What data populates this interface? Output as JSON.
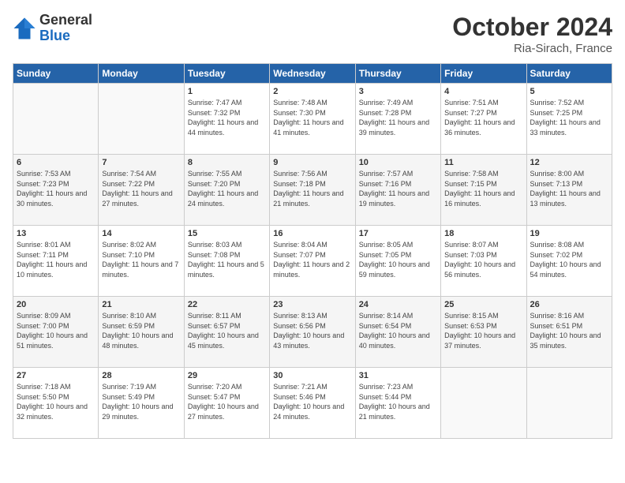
{
  "logo": {
    "general": "General",
    "blue": "Blue"
  },
  "title": "October 2024",
  "location": "Ria-Sirach, France",
  "days_header": [
    "Sunday",
    "Monday",
    "Tuesday",
    "Wednesday",
    "Thursday",
    "Friday",
    "Saturday"
  ],
  "weeks": [
    [
      {
        "day": "",
        "sunrise": "",
        "sunset": "",
        "daylight": ""
      },
      {
        "day": "",
        "sunrise": "",
        "sunset": "",
        "daylight": ""
      },
      {
        "day": "1",
        "sunrise": "Sunrise: 7:47 AM",
        "sunset": "Sunset: 7:32 PM",
        "daylight": "Daylight: 11 hours and 44 minutes."
      },
      {
        "day": "2",
        "sunrise": "Sunrise: 7:48 AM",
        "sunset": "Sunset: 7:30 PM",
        "daylight": "Daylight: 11 hours and 41 minutes."
      },
      {
        "day": "3",
        "sunrise": "Sunrise: 7:49 AM",
        "sunset": "Sunset: 7:28 PM",
        "daylight": "Daylight: 11 hours and 39 minutes."
      },
      {
        "day": "4",
        "sunrise": "Sunrise: 7:51 AM",
        "sunset": "Sunset: 7:27 PM",
        "daylight": "Daylight: 11 hours and 36 minutes."
      },
      {
        "day": "5",
        "sunrise": "Sunrise: 7:52 AM",
        "sunset": "Sunset: 7:25 PM",
        "daylight": "Daylight: 11 hours and 33 minutes."
      }
    ],
    [
      {
        "day": "6",
        "sunrise": "Sunrise: 7:53 AM",
        "sunset": "Sunset: 7:23 PM",
        "daylight": "Daylight: 11 hours and 30 minutes."
      },
      {
        "day": "7",
        "sunrise": "Sunrise: 7:54 AM",
        "sunset": "Sunset: 7:22 PM",
        "daylight": "Daylight: 11 hours and 27 minutes."
      },
      {
        "day": "8",
        "sunrise": "Sunrise: 7:55 AM",
        "sunset": "Sunset: 7:20 PM",
        "daylight": "Daylight: 11 hours and 24 minutes."
      },
      {
        "day": "9",
        "sunrise": "Sunrise: 7:56 AM",
        "sunset": "Sunset: 7:18 PM",
        "daylight": "Daylight: 11 hours and 21 minutes."
      },
      {
        "day": "10",
        "sunrise": "Sunrise: 7:57 AM",
        "sunset": "Sunset: 7:16 PM",
        "daylight": "Daylight: 11 hours and 19 minutes."
      },
      {
        "day": "11",
        "sunrise": "Sunrise: 7:58 AM",
        "sunset": "Sunset: 7:15 PM",
        "daylight": "Daylight: 11 hours and 16 minutes."
      },
      {
        "day": "12",
        "sunrise": "Sunrise: 8:00 AM",
        "sunset": "Sunset: 7:13 PM",
        "daylight": "Daylight: 11 hours and 13 minutes."
      }
    ],
    [
      {
        "day": "13",
        "sunrise": "Sunrise: 8:01 AM",
        "sunset": "Sunset: 7:11 PM",
        "daylight": "Daylight: 11 hours and 10 minutes."
      },
      {
        "day": "14",
        "sunrise": "Sunrise: 8:02 AM",
        "sunset": "Sunset: 7:10 PM",
        "daylight": "Daylight: 11 hours and 7 minutes."
      },
      {
        "day": "15",
        "sunrise": "Sunrise: 8:03 AM",
        "sunset": "Sunset: 7:08 PM",
        "daylight": "Daylight: 11 hours and 5 minutes."
      },
      {
        "day": "16",
        "sunrise": "Sunrise: 8:04 AM",
        "sunset": "Sunset: 7:07 PM",
        "daylight": "Daylight: 11 hours and 2 minutes."
      },
      {
        "day": "17",
        "sunrise": "Sunrise: 8:05 AM",
        "sunset": "Sunset: 7:05 PM",
        "daylight": "Daylight: 10 hours and 59 minutes."
      },
      {
        "day": "18",
        "sunrise": "Sunrise: 8:07 AM",
        "sunset": "Sunset: 7:03 PM",
        "daylight": "Daylight: 10 hours and 56 minutes."
      },
      {
        "day": "19",
        "sunrise": "Sunrise: 8:08 AM",
        "sunset": "Sunset: 7:02 PM",
        "daylight": "Daylight: 10 hours and 54 minutes."
      }
    ],
    [
      {
        "day": "20",
        "sunrise": "Sunrise: 8:09 AM",
        "sunset": "Sunset: 7:00 PM",
        "daylight": "Daylight: 10 hours and 51 minutes."
      },
      {
        "day": "21",
        "sunrise": "Sunrise: 8:10 AM",
        "sunset": "Sunset: 6:59 PM",
        "daylight": "Daylight: 10 hours and 48 minutes."
      },
      {
        "day": "22",
        "sunrise": "Sunrise: 8:11 AM",
        "sunset": "Sunset: 6:57 PM",
        "daylight": "Daylight: 10 hours and 45 minutes."
      },
      {
        "day": "23",
        "sunrise": "Sunrise: 8:13 AM",
        "sunset": "Sunset: 6:56 PM",
        "daylight": "Daylight: 10 hours and 43 minutes."
      },
      {
        "day": "24",
        "sunrise": "Sunrise: 8:14 AM",
        "sunset": "Sunset: 6:54 PM",
        "daylight": "Daylight: 10 hours and 40 minutes."
      },
      {
        "day": "25",
        "sunrise": "Sunrise: 8:15 AM",
        "sunset": "Sunset: 6:53 PM",
        "daylight": "Daylight: 10 hours and 37 minutes."
      },
      {
        "day": "26",
        "sunrise": "Sunrise: 8:16 AM",
        "sunset": "Sunset: 6:51 PM",
        "daylight": "Daylight: 10 hours and 35 minutes."
      }
    ],
    [
      {
        "day": "27",
        "sunrise": "Sunrise: 7:18 AM",
        "sunset": "Sunset: 5:50 PM",
        "daylight": "Daylight: 10 hours and 32 minutes."
      },
      {
        "day": "28",
        "sunrise": "Sunrise: 7:19 AM",
        "sunset": "Sunset: 5:49 PM",
        "daylight": "Daylight: 10 hours and 29 minutes."
      },
      {
        "day": "29",
        "sunrise": "Sunrise: 7:20 AM",
        "sunset": "Sunset: 5:47 PM",
        "daylight": "Daylight: 10 hours and 27 minutes."
      },
      {
        "day": "30",
        "sunrise": "Sunrise: 7:21 AM",
        "sunset": "Sunset: 5:46 PM",
        "daylight": "Daylight: 10 hours and 24 minutes."
      },
      {
        "day": "31",
        "sunrise": "Sunrise: 7:23 AM",
        "sunset": "Sunset: 5:44 PM",
        "daylight": "Daylight: 10 hours and 21 minutes."
      },
      {
        "day": "",
        "sunrise": "",
        "sunset": "",
        "daylight": ""
      },
      {
        "day": "",
        "sunrise": "",
        "sunset": "",
        "daylight": ""
      }
    ]
  ]
}
